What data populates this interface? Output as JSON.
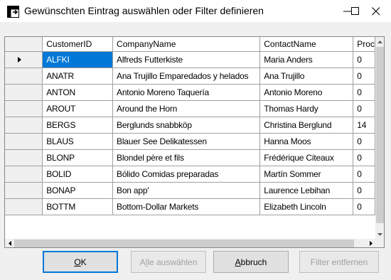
{
  "window": {
    "title": "Gewünschten Eintrag auswählen oder Filter definieren"
  },
  "grid": {
    "columns": [
      "CustomerID",
      "CompanyName",
      "ContactName",
      "Proc"
    ],
    "rows": [
      {
        "id": "ALFKI",
        "company": "Alfreds Futterkiste",
        "contact": "Maria Anders",
        "proc": "0"
      },
      {
        "id": "ANATR",
        "company": "Ana Trujillo Emparedados y helados",
        "contact": "Ana Trujillo",
        "proc": "0"
      },
      {
        "id": "ANTON",
        "company": "Antonio Moreno Taquería",
        "contact": "Antonio Moreno",
        "proc": "0"
      },
      {
        "id": "AROUT",
        "company": "Around the Horn",
        "contact": "Thomas Hardy",
        "proc": "0"
      },
      {
        "id": "BERGS",
        "company": "Berglunds snabbköp",
        "contact": "Christina Berglund",
        "proc": "14"
      },
      {
        "id": "BLAUS",
        "company": "Blauer See Delikatessen",
        "contact": "Hanna Moos",
        "proc": "0"
      },
      {
        "id": "BLONP",
        "company": "Blondel père et fils",
        "contact": "Frédérique Citeaux",
        "proc": "0"
      },
      {
        "id": "BOLID",
        "company": "Bólido Comidas preparadas",
        "contact": "Martín Sommer",
        "proc": "0"
      },
      {
        "id": "BONAP",
        "company": "Bon app'",
        "contact": "Laurence Lebihan",
        "proc": "0"
      },
      {
        "id": "BOTTM",
        "company": "Bottom-Dollar Markets",
        "contact": "Elizabeth Lincoln",
        "proc": "0"
      }
    ]
  },
  "buttons": {
    "ok_pre": "",
    "ok_key": "O",
    "ok_post": "K",
    "all_pre": "A",
    "all_key": "l",
    "all_post": "le auswählen",
    "cancel_pre": "",
    "cancel_key": "A",
    "cancel_post": "bbruch",
    "filter": "Filter entfernen"
  },
  "colors": {
    "selection": "#0078d7",
    "default_button_border": "#0078d7"
  }
}
